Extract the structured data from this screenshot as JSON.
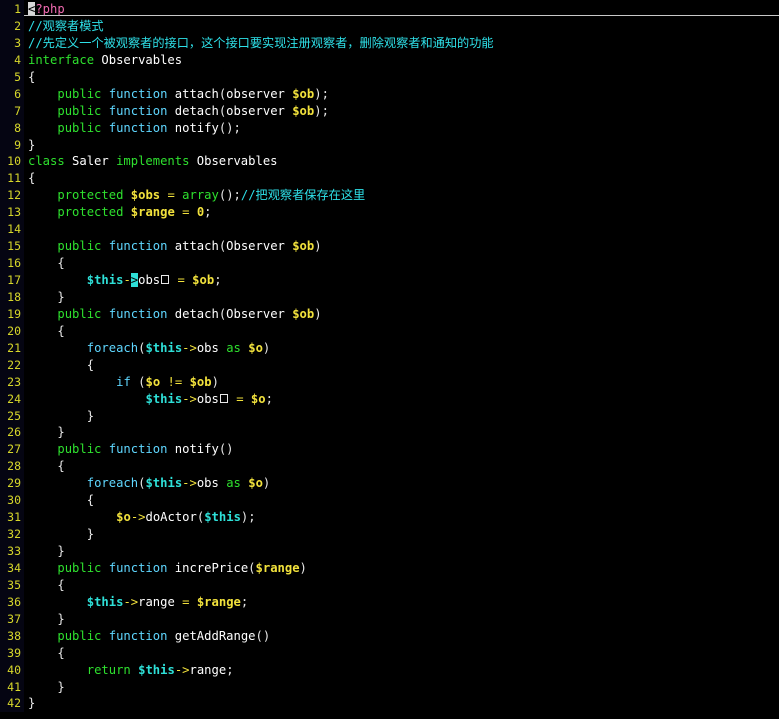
{
  "editor": {
    "language": "php",
    "filename_hint": "",
    "background": "#000000",
    "gutter_background": "#050512",
    "line_number_color": "#d7d72b",
    "default_text_color": "#e8e8e8",
    "cursor_color": "#2ee0d8",
    "selection_color": "#d8d8d8",
    "total_lines": 42,
    "cursor_line": 17,
    "cursor_char": ">"
  },
  "palette": {
    "keyword": "#2ee02e",
    "function": "#5fd7ff",
    "variable": "#f2e23c",
    "this_variable": "#2ee0d8",
    "identifier": "#ffffff",
    "comment": "#2ee0e8",
    "punctuation": "#e8e8e8",
    "operator": "#f2e23c",
    "number": "#f2e23c",
    "php_tag": "#f06ab0"
  },
  "line_numbers": [
    "1",
    "2",
    "3",
    "4",
    "5",
    "6",
    "7",
    "8",
    "9",
    "10",
    "11",
    "12",
    "13",
    "14",
    "15",
    "16",
    "17",
    "18",
    "19",
    "20",
    "21",
    "22",
    "23",
    "24",
    "25",
    "26",
    "27",
    "28",
    "29",
    "30",
    "31",
    "32",
    "33",
    "34",
    "35",
    "36",
    "37",
    "38",
    "39",
    "40",
    "41",
    "42"
  ],
  "lines": [
    {
      "n": 1,
      "text": "<?php"
    },
    {
      "n": 2,
      "text": "//观察者模式"
    },
    {
      "n": 3,
      "text": "//先定义一个被观察者的接口，这个接口要实现注册观察者，删除观察者和通知的功能"
    },
    {
      "n": 4,
      "text": "interface Observables"
    },
    {
      "n": 5,
      "text": "{"
    },
    {
      "n": 6,
      "text": "    public function attach(observer $ob);"
    },
    {
      "n": 7,
      "text": "    public function detach(observer $ob);"
    },
    {
      "n": 8,
      "text": "    public function notify();"
    },
    {
      "n": 9,
      "text": "}"
    },
    {
      "n": 10,
      "text": "class Saler implements Observables"
    },
    {
      "n": 11,
      "text": "{"
    },
    {
      "n": 12,
      "text": "    protected $obs = array();//把观察者保存在这里"
    },
    {
      "n": 13,
      "text": "    protected $range = 0;"
    },
    {
      "n": 14,
      "text": ""
    },
    {
      "n": 15,
      "text": "    public function attach(Observer $ob)"
    },
    {
      "n": 16,
      "text": "    {"
    },
    {
      "n": 17,
      "text": "        $this->obs[] = $ob;"
    },
    {
      "n": 18,
      "text": "    }"
    },
    {
      "n": 19,
      "text": "    public function detach(Observer $ob)"
    },
    {
      "n": 20,
      "text": "    {"
    },
    {
      "n": 21,
      "text": "        foreach($this->obs as $o)"
    },
    {
      "n": 22,
      "text": "        {"
    },
    {
      "n": 23,
      "text": "            if ($o != $ob)"
    },
    {
      "n": 24,
      "text": "                $this->obs[] = $o;"
    },
    {
      "n": 25,
      "text": "        }"
    },
    {
      "n": 26,
      "text": "    }"
    },
    {
      "n": 27,
      "text": "    public function notify()"
    },
    {
      "n": 28,
      "text": "    {"
    },
    {
      "n": 29,
      "text": "        foreach($this->obs as $o)"
    },
    {
      "n": 30,
      "text": "        {"
    },
    {
      "n": 31,
      "text": "            $o->doActor($this);"
    },
    {
      "n": 32,
      "text": "        }"
    },
    {
      "n": 33,
      "text": "    }"
    },
    {
      "n": 34,
      "text": "    public function increPrice($range)"
    },
    {
      "n": 35,
      "text": "    {"
    },
    {
      "n": 36,
      "text": "        $this->range = $range;"
    },
    {
      "n": 37,
      "text": "    }"
    },
    {
      "n": 38,
      "text": "    public function getAddRange()"
    },
    {
      "n": 39,
      "text": "    {"
    },
    {
      "n": 40,
      "text": "        return $this->range;"
    },
    {
      "n": 41,
      "text": "    }"
    },
    {
      "n": 42,
      "text": "}"
    }
  ],
  "tokens": {
    "keywords": [
      "public",
      "protected",
      "interface",
      "class",
      "implements",
      "return",
      "function",
      "foreach",
      "if",
      "as",
      "array"
    ],
    "variables": [
      "$ob",
      "$obs",
      "$o",
      "$range",
      "$this"
    ],
    "identifiers": [
      "Observables",
      "Saler",
      "Observer",
      "observer",
      "attach",
      "detach",
      "notify",
      "doActor",
      "increPrice",
      "getAddRange"
    ],
    "comments": [
      "//观察者模式",
      "//先定义一个被观察者的接口，这个接口要实现注册观察者，删除观察者和通知的功能",
      "//把观察者保存在这里"
    ],
    "numbers": [
      "0"
    ],
    "php_open_tag": "<?php"
  }
}
